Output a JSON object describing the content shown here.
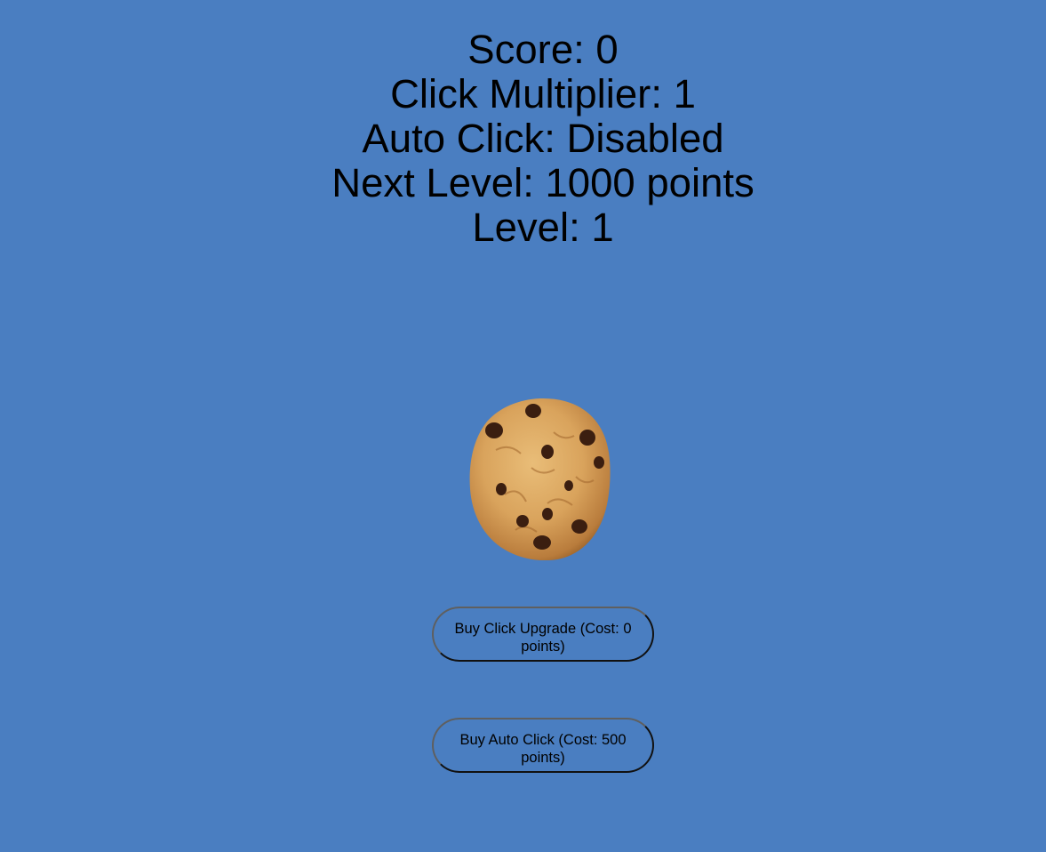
{
  "stats": {
    "score": "Score: 0",
    "click_multiplier": "Click Multiplier: 1",
    "auto_click": "Auto Click: Disabled",
    "next_level": "Next Level: 1000 points",
    "level": "Level: 1"
  },
  "cookie": {
    "icon": "cookie-icon"
  },
  "buttons": {
    "click_upgrade": "Buy Click Upgrade (Cost: 0 points)",
    "auto_click": "Buy Auto Click (Cost: 500 points)"
  },
  "colors": {
    "background": "#4a7ec1",
    "text": "#000000",
    "cookie_base": "#d9a35c",
    "chocolate": "#3b1e10"
  }
}
